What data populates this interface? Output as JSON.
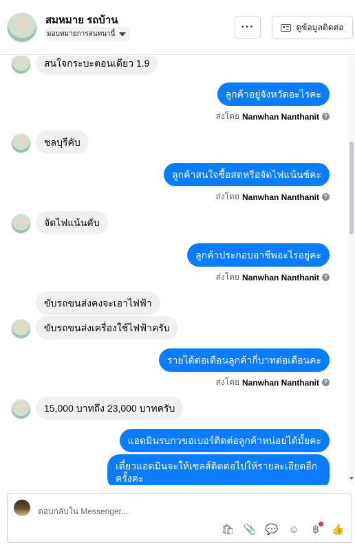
{
  "header": {
    "name": "สมหมาย รถบ้าน",
    "assign_label": "มอบหมายการสนทนานี้",
    "more_label": "···",
    "contact_label": "ดูข้อมูลติดต่อ"
  },
  "thread": {
    "messages": [
      {
        "side": "in",
        "text": "สนใจกระบะตอนเดียว 1.9"
      },
      {
        "side": "out",
        "text": "ลูกค้าอยู่จังหวัดอะไรคะ"
      },
      {
        "side": "in",
        "text": "ชลบุรีคับ"
      },
      {
        "side": "out",
        "text": "ลูกค้าสนใจซื้อสดหรือจัดไฟแน้นซ์คะ"
      },
      {
        "side": "in",
        "text": "จัดไฟแน้นคับ"
      },
      {
        "side": "out",
        "text": "ลูกค้าประกอบอาชีพอะไรอยู่คะ"
      },
      {
        "side": "in",
        "text": "ขับรถขนส่งคงจะเอาไฟฟ้า"
      },
      {
        "side": "in",
        "text": "ขับรถขนส่งเครื่องใช้ไฟฟ้าครับ"
      },
      {
        "side": "out",
        "text": "รายได้ต่อเดือนลูกค้ากี่บาทต่อเดือนคะ"
      },
      {
        "side": "in",
        "text": "15,000 บาทถึง 23,000 บาทครับ"
      },
      {
        "side": "out",
        "text": "แอดมินรบกวขอเบอร์ติดต่อลูกค้าหน่อยได้มั้ยคะ"
      },
      {
        "side": "out",
        "text": "เดี๋ยวแอดมินจะให้เซลส์ติดต่อไปให้รายละเอียดอีกครั้งค่ะ"
      }
    ],
    "sent_by_prefix": "ส่งโดย",
    "sent_by_name": "Nanwhan Nanthanit",
    "help_glyph": "?"
  },
  "composer": {
    "placeholder": "ตอบกลับใน Messenger...",
    "tools": [
      {
        "name": "shopping-bag-icon",
        "glyph": "🛍"
      },
      {
        "name": "attachment-icon",
        "glyph": "📎"
      },
      {
        "name": "saved-reply-icon",
        "glyph": "💬"
      },
      {
        "name": "emoji-icon",
        "glyph": "☺"
      },
      {
        "name": "payment-icon",
        "glyph": "฿"
      },
      {
        "name": "like-icon",
        "glyph": "👍"
      }
    ]
  },
  "colors": {
    "accent": "#0a7cff",
    "incoming_bubble": "#f0f0f0",
    "badge": "#f02849"
  }
}
